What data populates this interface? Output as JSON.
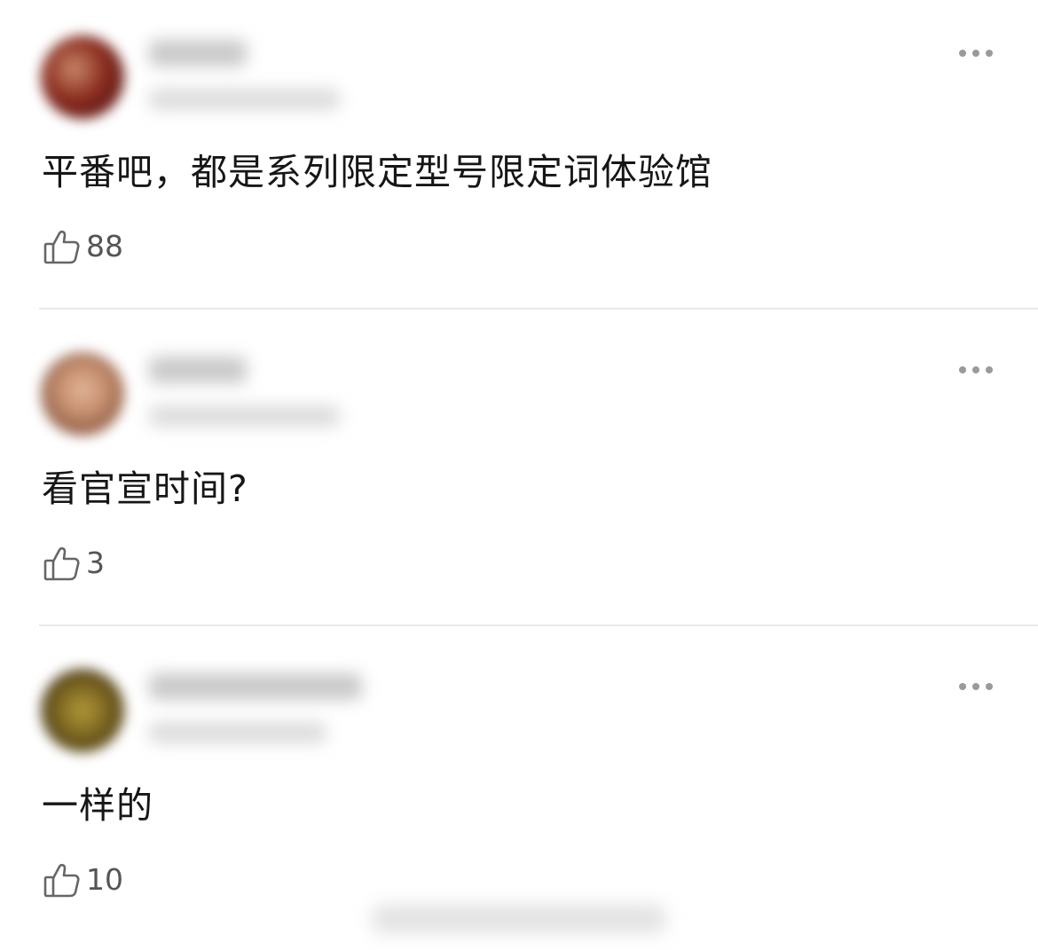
{
  "colors": {
    "text": "#161616",
    "like_count": "#555555",
    "divider": "#e9e9e9",
    "more_dots": "#9a9a9a"
  },
  "comments": [
    {
      "text": "平番吧，都是系列限定型号限定词体验馆",
      "likes": "88",
      "icons": {
        "like": "thumbs-up-icon",
        "more": "more-dots-icon"
      }
    },
    {
      "text": "看官宣时间?",
      "likes": "3",
      "icons": {
        "like": "thumbs-up-icon",
        "more": "more-dots-icon"
      }
    },
    {
      "text": "一样的",
      "likes": "10",
      "icons": {
        "like": "thumbs-up-icon",
        "more": "more-dots-icon"
      }
    }
  ]
}
